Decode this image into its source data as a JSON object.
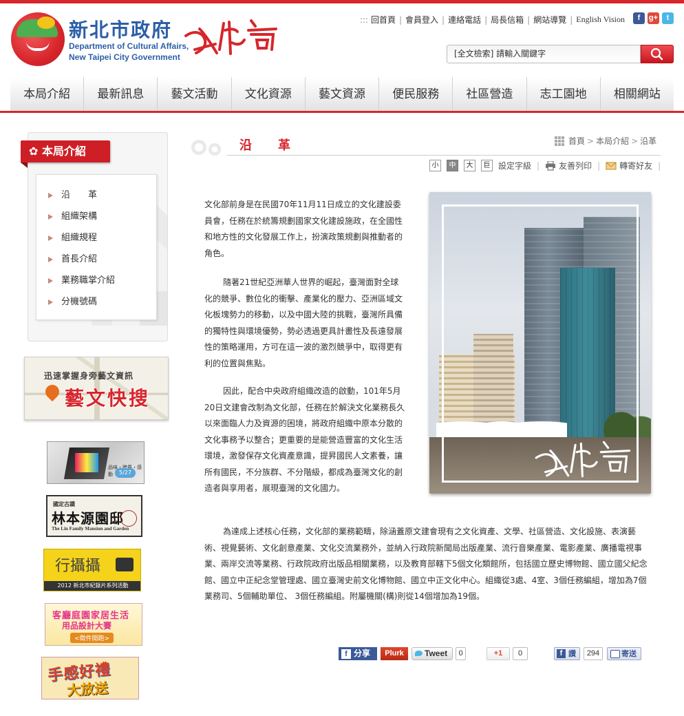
{
  "header": {
    "logo": {
      "name_zh": "新北市政府",
      "name_en_line1": "Department of Cultural Affairs,",
      "name_en_line2": "New Taipei City Government",
      "calligraphy": "文化局"
    },
    "toplinks": {
      "prefix": ":::",
      "items": [
        "回首頁",
        "會員登入",
        "連絡電話",
        "局長信箱",
        "網站導覽",
        "English Vision"
      ]
    },
    "social": {
      "facebook": "f",
      "google_plus": "g+",
      "twitter": "t"
    },
    "search": {
      "placeholder": "[全文檢索] 請輸入關鍵字"
    }
  },
  "nav": {
    "items": [
      "本局介紹",
      "最新訊息",
      "藝文活動",
      "文化資源",
      "藝文資源",
      "便民服務",
      "社區營造",
      "志工園地",
      "相關網站"
    ]
  },
  "sidebar": {
    "section_title": "本局介紹",
    "items": [
      "沿　　革",
      "組織架構",
      "組織規程",
      "首長介紹",
      "業務職掌介紹",
      "分機號碼"
    ],
    "banners": {
      "art_search": {
        "subtitle": "迅速掌握身旁藝文資訊",
        "title": "藝文快搜"
      },
      "banner1": {
        "tagline": "品味・跨界・感動",
        "dates": "5/27"
      },
      "lin_garden": {
        "small": "國定古蹟",
        "title": "林本源園邸",
        "en": "The Lin Family Mansion and Garden"
      },
      "documentary": {
        "title": "行攝攝",
        "footer": "2012 新北市紀錄片系列活動"
      },
      "design_contest": {
        "line1": "客廳庭園家居生活",
        "line2": "用品設計大賽",
        "line3": "<徵件開跑>"
      },
      "gift": {
        "line1": "手感好禮",
        "line2": "大放送"
      }
    }
  },
  "content": {
    "title": "沿革",
    "breadcrumb": [
      "首頁",
      "本局介紹",
      "沿革"
    ],
    "tools": {
      "font_small": "小",
      "font_medium": "中",
      "font_large": "大",
      "font_set_icon": "巨",
      "font_setting": "設定字級",
      "print": "友善列印",
      "forward": "轉寄好友"
    },
    "paragraphs": [
      "文化部前身是在民國70年11月11日成立的文化建設委員會，任務在於統籌規劃國家文化建設施政，在全國性和地方性的文化發展工作上，扮演政策規劃與推動者的角色。",
      "隨著21世紀亞洲華人世界的崛起，臺灣面對全球化的競爭、數位化的衝擊、產業化的壓力、亞洲區域文化板塊勢力的移動，以及中國大陸的挑戰，臺灣所具備的獨特性與環境優勢，勢必透過更具計畫性及長遠發展性的策略運用，方可在這一波的激烈競爭中，取得更有利的位置與焦點。",
      "因此，配合中央政府組織改造的啟動，101年5月20日文建會改制為文化部，任務在於解決文化業務長久以來面臨人力及資源的困境，將政府組織中原本分散的文化事務予以整合；更重要的是能營造豐富的文化生活環境，激發保存文化資產意識，提昇國民人文素養，讓所有國民，不分族群、不分階級，都成為臺灣文化的創造者與享用者，展現臺灣的文化國力。",
      "為達成上述核心任務，文化部的業務範疇，除涵蓋原文建會現有之文化資產、文學、社區營造、文化設施、表演藝術、視覺藝術、文化創意產業、文化交流業務外，並納入行政院新聞局出版產業、流行音樂產業、電影產業、廣播電視事業、兩岸交流等業務、行政院政府出版品相關業務，以及教育部轄下5個文化類館所，包括國立歷史博物館、國立國父紀念館、國立中正紀念堂管理處、國立臺灣史前文化博物館、國立中正文化中心。組織從3處、4室、3個任務編組，增加為7個業務司、5個輔助單位、 3個任務編組。附屬機關(構)則從14個增加為19個。"
    ]
  },
  "share": {
    "facebook_label": "分享",
    "plurk_label": "Plurk",
    "tweet_label": "Tweet",
    "tweet_count": "0",
    "gplus_label": "+1",
    "gplus_count": "0",
    "like_label": "讚",
    "like_count": "294",
    "send_label": "寄送"
  },
  "colors": {
    "accent": "#d7262c",
    "link": "#2c5fa8",
    "facebook": "#3b5998"
  }
}
